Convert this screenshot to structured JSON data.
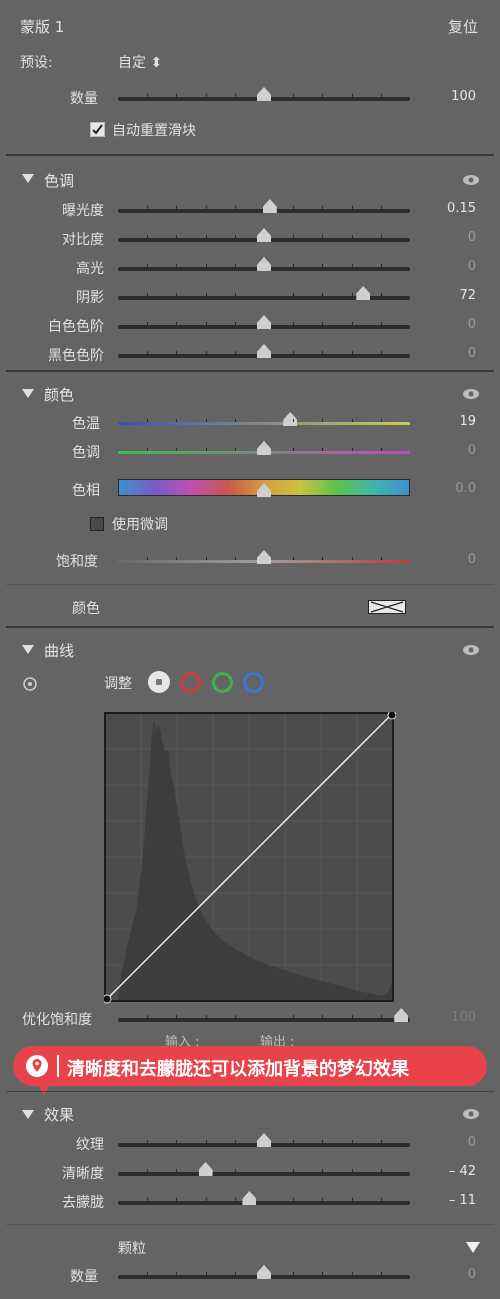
{
  "mask": {
    "title": "蒙版 1",
    "reset": "复位",
    "preset_label": "预设:",
    "preset_value": "自定 ⬍",
    "amount_label": "数量",
    "amount_value": "100",
    "auto_reset_label": "自动重置滑块"
  },
  "tone": {
    "title": "色调",
    "sliders": [
      {
        "label": "曝光度",
        "value": "0.15",
        "pos": 0.52
      },
      {
        "label": "对比度",
        "value": "0",
        "pos": 0.5
      },
      {
        "label": "高光",
        "value": "0",
        "pos": 0.5
      },
      {
        "label": "阴影",
        "value": "72",
        "pos": 0.84
      },
      {
        "label": "白色色阶",
        "value": "0",
        "pos": 0.5
      },
      {
        "label": "黑色色阶",
        "value": "0",
        "pos": 0.5
      }
    ]
  },
  "color": {
    "title": "颜色",
    "temp_label": "色温",
    "temp_value": "19",
    "temp_pos": 0.59,
    "tint_label": "色调",
    "tint_value": "0",
    "tint_pos": 0.5,
    "hue_label": "色相",
    "hue_value": "0.0",
    "hue_pos": 0.5,
    "fine_label": "使用微调",
    "sat_label": "饱和度",
    "sat_value": "0",
    "sat_pos": 0.5,
    "color_label": "颜色"
  },
  "curve": {
    "title": "曲线",
    "adjust_label": "调整",
    "refine_label": "优化饱和度",
    "refine_value": "100",
    "input_label": "输入 :",
    "output_label": "输出 :"
  },
  "banner": {
    "text": "清晰度和去朦胧还可以添加背景的梦幻效果"
  },
  "effects": {
    "title": "效果",
    "sliders": [
      {
        "label": "纹理",
        "value": "0",
        "pos": 0.5
      },
      {
        "label": "清晰度",
        "value": "– 42",
        "pos": 0.3
      },
      {
        "label": "去朦胧",
        "value": "– 11",
        "pos": 0.45
      }
    ],
    "grain_label": "颗粒",
    "grain_amount_label": "数量",
    "grain_amount_value": "0"
  },
  "colors": {
    "bg": "#646464",
    "banner": "#e8434b",
    "accent_red": "#d23a3a",
    "accent_green": "#3bb54a",
    "accent_blue": "#3a78d6"
  }
}
